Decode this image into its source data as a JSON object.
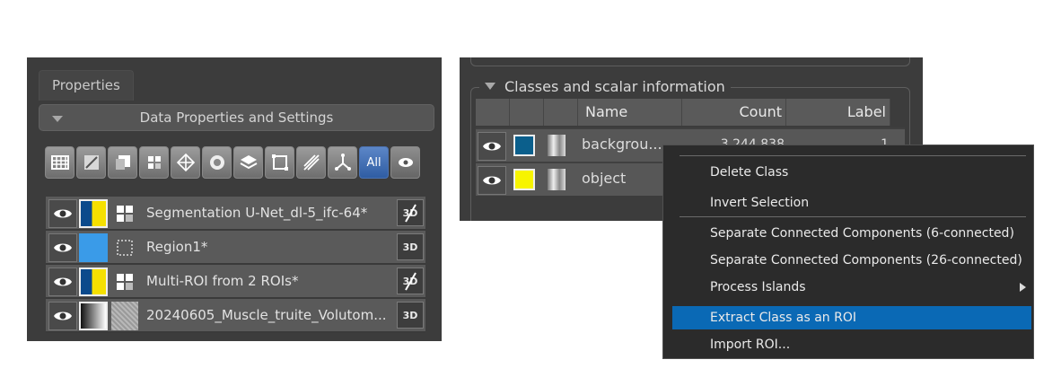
{
  "left_panel": {
    "tab_label": "Properties",
    "section_header": "Data Properties and Settings",
    "toolbar": {
      "buttons": [
        "grid-icon",
        "annotation-icon",
        "square-icon",
        "multi-roi-icon",
        "mesh-icon",
        "shape-icon",
        "layers-icon",
        "box-icon",
        "measure-icon",
        "graph-icon",
        "all-filter",
        "eye-filter"
      ],
      "all_label": "All"
    },
    "layers": [
      {
        "name": "Segmentation U-Net_dl-5_ifc-64*",
        "swatch": "yellow-blue",
        "type_icon": "multi-roi-icon",
        "badge": "3D",
        "badge_crossed": true
      },
      {
        "name": "Region1*",
        "swatch": "#3a9be8",
        "type_icon": "roi-icon",
        "badge": "3D",
        "badge_crossed": false
      },
      {
        "name": "Multi-ROI from 2 ROIs*",
        "swatch": "yellow-blue",
        "type_icon": "multi-roi-icon",
        "badge": "3D",
        "badge_crossed": true
      },
      {
        "name": "20240605_Muscle_truite_Volutom...",
        "swatch": "gradient",
        "type_icon": "volume-thumbnail",
        "badge": "3D",
        "badge_crossed": false
      }
    ]
  },
  "right_panel": {
    "group_title": "Classes and scalar information",
    "columns": [
      "Name",
      "Count",
      "Label"
    ],
    "classes": [
      {
        "name": "backgrou...",
        "count": "3,244,838",
        "label": "1",
        "color": "#0b5f8c"
      },
      {
        "name": "object",
        "count": "",
        "label": "",
        "color": "#f7f400"
      }
    ]
  },
  "context_menu": {
    "items": [
      {
        "label": "Delete Class",
        "highlighted": false,
        "submenu": false
      },
      {
        "label": "Invert Selection",
        "highlighted": false,
        "submenu": false
      },
      {
        "label": "Separate Connected Components (6-connected)",
        "highlighted": false,
        "submenu": false
      },
      {
        "label": "Separate Connected Components (26-connected)",
        "highlighted": false,
        "submenu": false
      },
      {
        "label": "Process Islands",
        "highlighted": false,
        "submenu": true
      },
      {
        "label": "Extract Class as an ROI",
        "highlighted": true,
        "submenu": false
      },
      {
        "label": "Import ROI...",
        "highlighted": false,
        "submenu": false
      }
    ]
  },
  "colors": {
    "panel_bg": "#3c3c3c",
    "row_bg": "#5a5a5a",
    "menu_bg": "#2b2b2b",
    "menu_highlight": "#0a69b5",
    "all_button": "#3e6fb8"
  }
}
